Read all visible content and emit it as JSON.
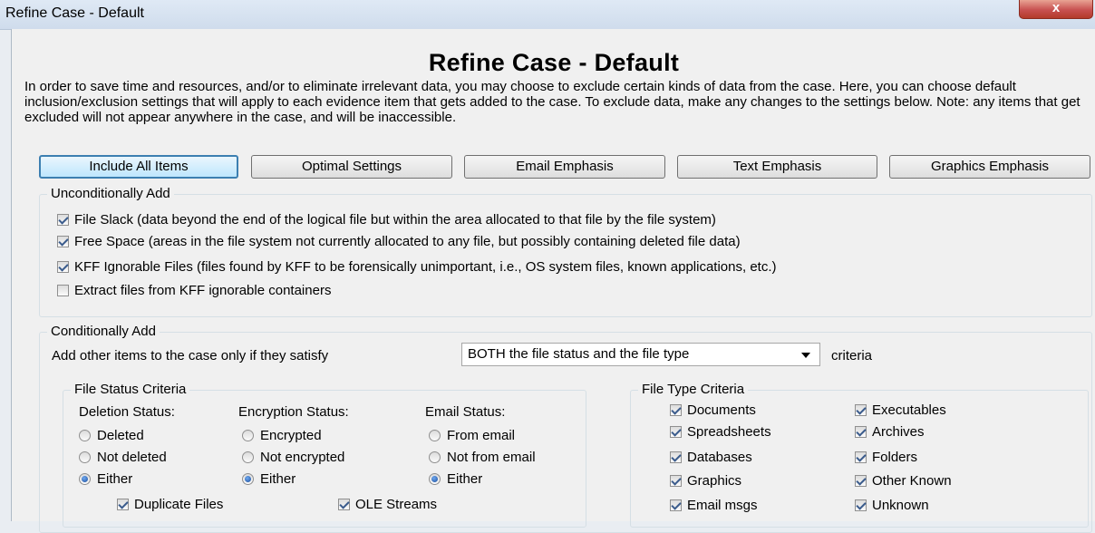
{
  "window": {
    "title": "Refine Case - Default",
    "close_label": "x"
  },
  "heading": "Refine Case - Default",
  "description": "In order to save time and resources, and/or to eliminate irrelevant data, you may choose to exclude certain kinds of data from the case. Here, you can choose default inclusion/exclusion settings that will apply to each evidence item that gets added to the case. To exclude data, make any changes to the settings below. Note: any items that get excluded will not appear anywhere in the case, and will be inaccessible.",
  "presets": {
    "include_all": "Include All Items",
    "optimal": "Optimal Settings",
    "email": "Email Emphasis",
    "text": "Text Emphasis",
    "graphics": "Graphics Emphasis"
  },
  "unconditional": {
    "label": "Unconditionally Add",
    "items": [
      {
        "label": "File Slack (data beyond the end of the logical file but within the area allocated to that file by the file system)",
        "checked": true
      },
      {
        "label": "Free Space (areas in the file system not currently allocated to any file, but possibly containing deleted file data)",
        "checked": true
      },
      {
        "label": "KFF Ignorable Files (files found by KFF to be forensically unimportant, i.e., OS system files, known applications, etc.)",
        "checked": true
      },
      {
        "label": "Extract files from KFF ignorable containers",
        "checked": false
      }
    ]
  },
  "conditional": {
    "label": "Conditionally Add",
    "prompt": "Add other items to the case only if they satisfy",
    "combo_value": "BOTH the file status and the file type",
    "suffix": "criteria"
  },
  "file_status": {
    "label": "File Status Criteria",
    "deletion": {
      "label": "Deletion Status:",
      "options": [
        "Deleted",
        "Not deleted",
        "Either"
      ],
      "selected": "Either"
    },
    "encryption": {
      "label": "Encryption Status:",
      "options": [
        "Encrypted",
        "Not encrypted",
        "Either"
      ],
      "selected": "Either"
    },
    "email": {
      "label": "Email Status:",
      "options": [
        "From email",
        "Not from email",
        "Either"
      ],
      "selected": "Either"
    },
    "duplicate_files": {
      "label": "Duplicate Files",
      "checked": true
    },
    "ole_streams": {
      "label": "OLE Streams",
      "checked": true
    }
  },
  "file_type": {
    "label": "File Type Criteria",
    "left": [
      {
        "label": "Documents",
        "checked": true
      },
      {
        "label": "Spreadsheets",
        "checked": true
      },
      {
        "label": "Databases",
        "checked": true
      },
      {
        "label": "Graphics",
        "checked": true
      },
      {
        "label": "Email msgs",
        "checked": true
      }
    ],
    "right": [
      {
        "label": "Executables",
        "checked": true
      },
      {
        "label": "Archives",
        "checked": true
      },
      {
        "label": "Folders",
        "checked": true
      },
      {
        "label": "Other Known",
        "checked": true
      },
      {
        "label": "Unknown",
        "checked": true
      }
    ]
  }
}
